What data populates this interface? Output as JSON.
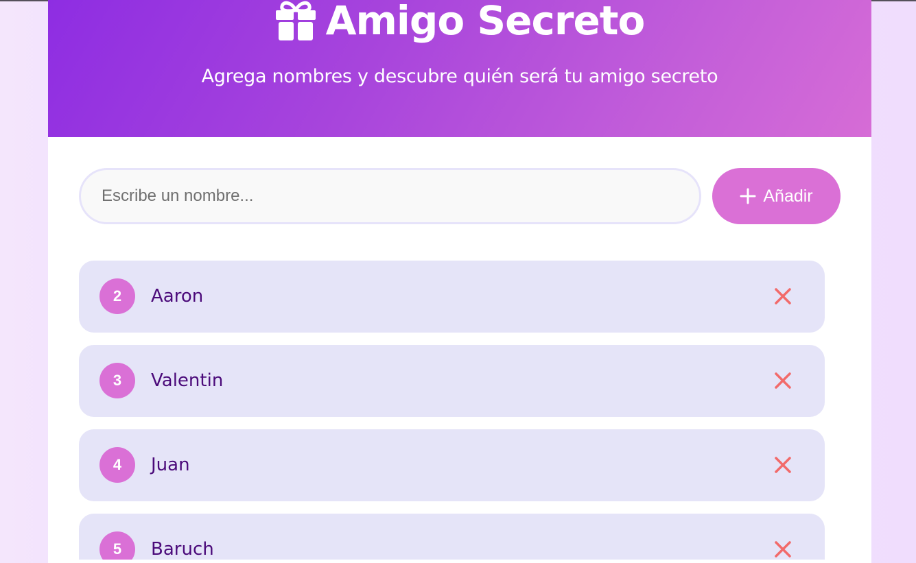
{
  "header": {
    "title": "Amigo Secreto",
    "subtitle": "Agrega nombres y descubre quién será tu amigo secreto",
    "icon": "gift-icon"
  },
  "input": {
    "placeholder": "Escribe un nombre...",
    "value": ""
  },
  "add_button": {
    "label": "Añadir",
    "icon": "plus-icon"
  },
  "friends": [
    {
      "number": "2",
      "name": "Aaron"
    },
    {
      "number": "3",
      "name": "Valentin"
    },
    {
      "number": "4",
      "name": "Juan"
    },
    {
      "number": "5",
      "name": "Baruch"
    }
  ],
  "colors": {
    "header_gradient_start": "#8e2de2",
    "header_gradient_end": "#d66cd6",
    "accent": "#da70d6",
    "item_background": "#e5e4f8",
    "name_text": "#4b0a7a",
    "remove_icon": "#f26a6a"
  }
}
